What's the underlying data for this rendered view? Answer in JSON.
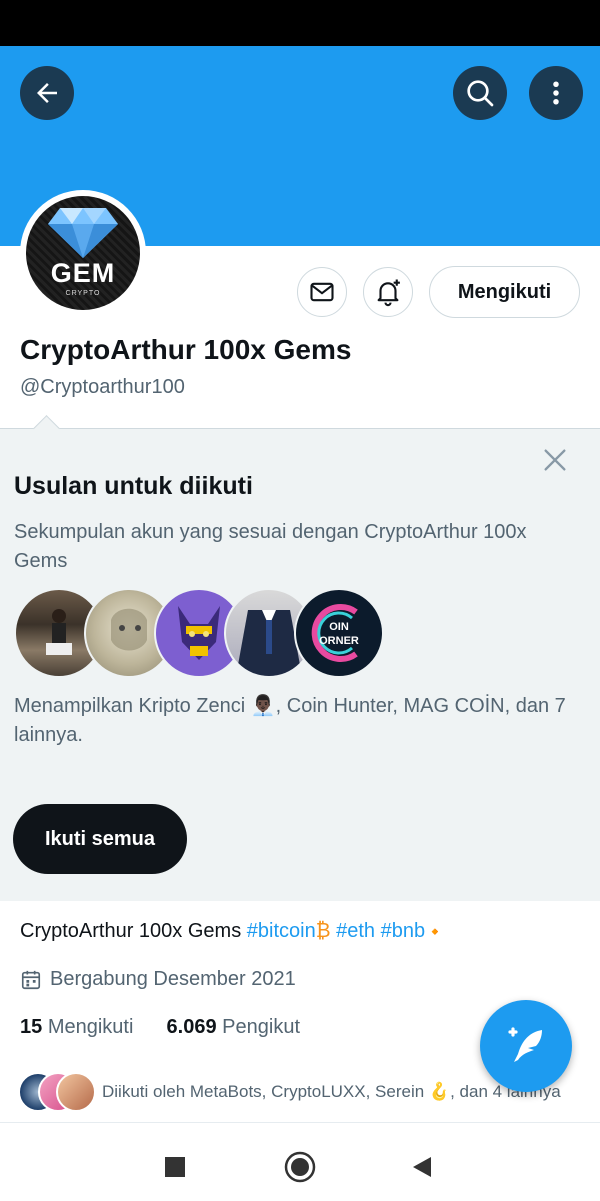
{
  "colors": {
    "accent": "#1d9bf0",
    "text": "#0f1419",
    "muted": "#536471",
    "panel_bg": "#eff3f4"
  },
  "header": {
    "icons": [
      "back-arrow-icon",
      "search-icon",
      "more-vertical-icon"
    ]
  },
  "profile": {
    "avatar_text": "GEM",
    "avatar_subtext": "CRYPTO",
    "display_name": "CryptoArthur 100x Gems",
    "handle": "@Cryptoarthur100",
    "following_button": "Mengikuti"
  },
  "suggestions": {
    "title": "Usulan untuk diikuti",
    "description": "Sekumpulan akun yang sesuai dengan CryptoArthur 100x Gems",
    "avatar_text": "OIN ORNER",
    "featured": "Menampilkan Kripto Zenci 👨🏿‍💼, Coin Hunter, MAG COİN, dan 7 lainnya.",
    "follow_all": "Ikuti semua"
  },
  "bio": {
    "text": "CryptoArthur 100x Gems",
    "hashtags": [
      "#bitcoin",
      "#eth",
      "#bnb"
    ],
    "emoji": [
      "₿",
      "🔸"
    ]
  },
  "joined": "Bergabung Desember 2021",
  "stats": {
    "following_count": "15",
    "following_label": "Mengikuti",
    "followers_count": "6.069",
    "followers_label": "Pengikut"
  },
  "followed_by": "Diikuti oleh MetaBots, CryptoLUXX, Serein 🪝, dan 4 lainnya"
}
